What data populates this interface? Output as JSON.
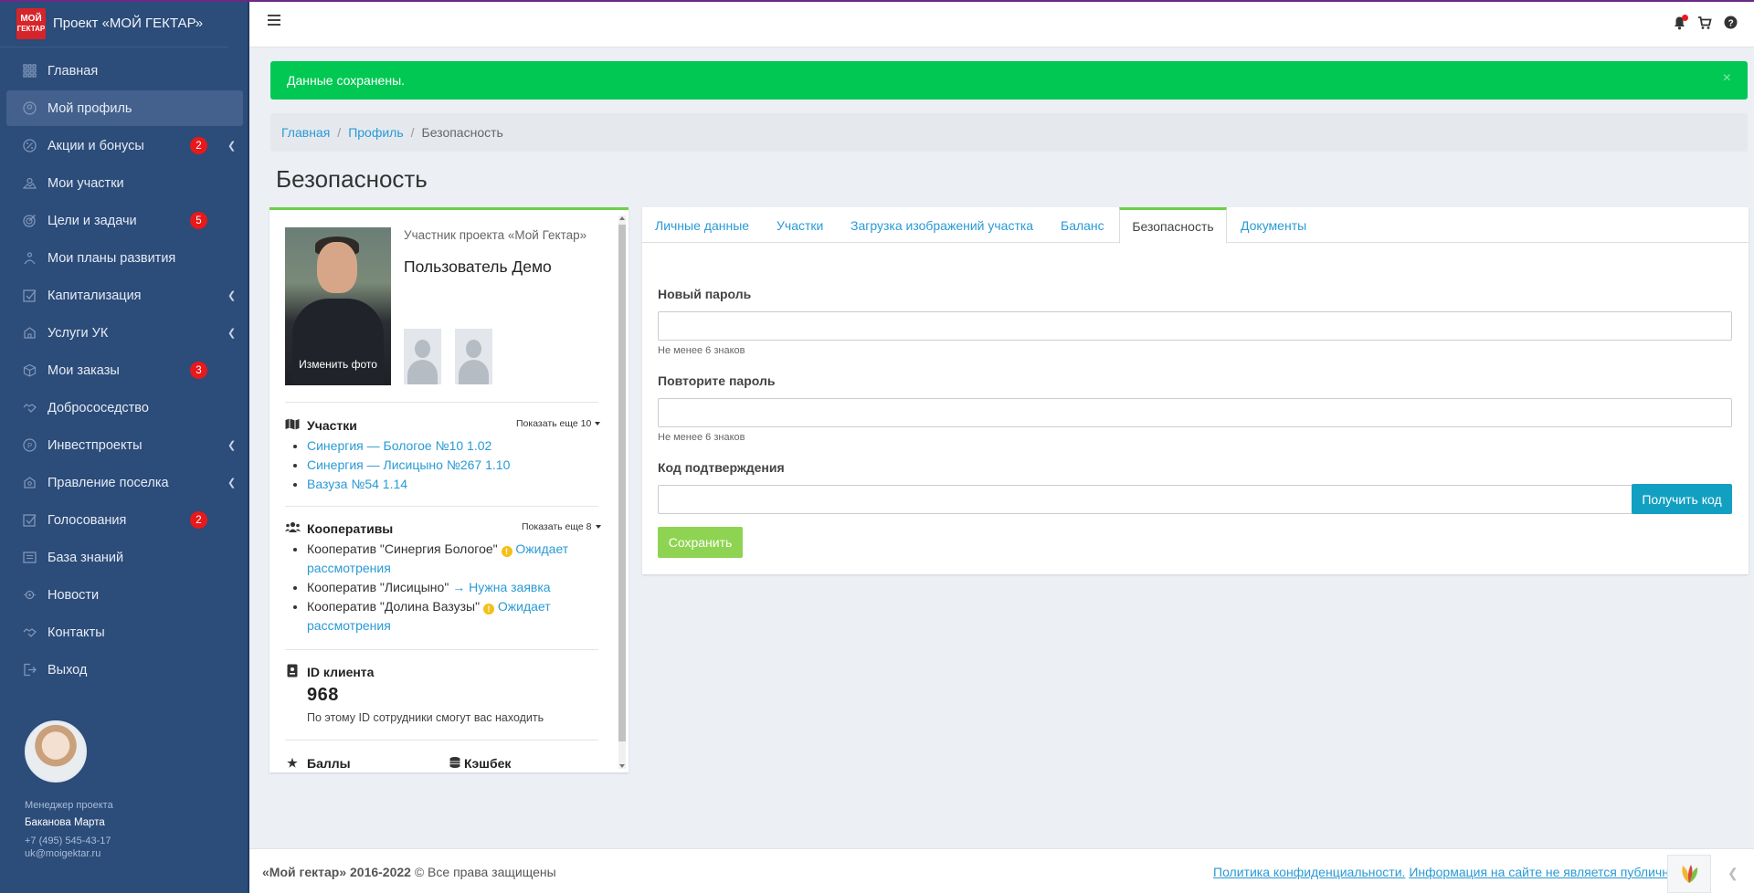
{
  "brand": {
    "logo_line1": "МОЙ",
    "logo_line2": "ГЕКТАР",
    "title": "Проект «МОЙ ГЕКТАР»"
  },
  "sidebar": {
    "items": [
      {
        "label": "Главная",
        "icon": "grid-icon"
      },
      {
        "label": "Мой профиль",
        "icon": "user-circle-icon",
        "active": true
      },
      {
        "label": "Акции и бонусы",
        "icon": "percent-icon",
        "badge": "2",
        "submenu": true
      },
      {
        "label": "Мои участки",
        "icon": "landscape-icon"
      },
      {
        "label": "Цели и задачи",
        "icon": "target-icon",
        "badge": "5"
      },
      {
        "label": "Мои планы развития",
        "icon": "plan-icon"
      },
      {
        "label": "Капитализация",
        "icon": "chart-check-icon",
        "submenu": true
      },
      {
        "label": "Услуги УК",
        "icon": "service-icon",
        "submenu": true
      },
      {
        "label": "Мои заказы",
        "icon": "box-icon",
        "badge": "3"
      },
      {
        "label": "Добрососедство",
        "icon": "handshake-icon"
      },
      {
        "label": "Инвестпроекты",
        "icon": "invest-icon",
        "submenu": true
      },
      {
        "label": "Правление поселка",
        "icon": "board-icon",
        "submenu": true
      },
      {
        "label": "Голосования",
        "icon": "vote-icon",
        "badge": "2"
      },
      {
        "label": "База знаний",
        "icon": "book-icon"
      },
      {
        "label": "Новости",
        "icon": "news-icon"
      },
      {
        "label": "Контакты",
        "icon": "contacts-icon"
      },
      {
        "label": "Выход",
        "icon": "logout-icon"
      }
    ]
  },
  "manager": {
    "role": "Менеджер проекта",
    "name": "Баканова Марта",
    "phone": "+7 (495) 545-43-17",
    "email": "uk@moigektar.ru"
  },
  "alert": {
    "text": "Данные сохранены.",
    "close": "×"
  },
  "breadcrumb": {
    "home": "Главная",
    "profile": "Профиль",
    "current": "Безопасность",
    "sep": "/"
  },
  "page_title": "Безопасность",
  "profile": {
    "role": "Участник проекта «Мой Гектар»",
    "name": "Пользователь Демо",
    "change_photo": "Изменить фото",
    "plots": {
      "title": "Участки",
      "show_more": "Показать еще 10",
      "items": [
        "Синергия — Бологое №10 1.02",
        "Синергия — Лисицыно №267 1.10",
        "Вазуза №54 1.14"
      ]
    },
    "coops": {
      "title": "Кооперативы",
      "show_more": "Показать еще 8",
      "items": [
        {
          "name": "Кооператив \"Синергия Бологое\"",
          "status": "Ожидает рассмотрения",
          "status_icon": "clock-warning-icon"
        },
        {
          "name": "Кооператив \"Лисицыно\"",
          "status": "Нужна заявка",
          "status_icon": "arrow-right-icon"
        },
        {
          "name": "Кооператив \"Долина Вазузы\"",
          "status": "Ожидает рассмотрения",
          "status_icon": "clock-warning-icon"
        }
      ]
    },
    "client": {
      "title": "ID клиента",
      "id": "968",
      "hint": "По этому ID сотрудники смогут вас находить"
    },
    "points_title": "Баллы",
    "cashback_title": "Кэшбек"
  },
  "tabs": [
    "Личные данные",
    "Участки",
    "Загрузка изображений участка",
    "Баланс",
    "Безопасность",
    "Документы"
  ],
  "active_tab": "Безопасность",
  "form": {
    "new_password_label": "Новый пароль",
    "new_password_value": "",
    "new_password_hint": "Не менее 6 знаков",
    "repeat_password_label": "Повторите пароль",
    "repeat_password_value": "",
    "repeat_password_hint": "Не менее 6 знаков",
    "code_label": "Код подтверждения",
    "code_value": "",
    "get_code_button": "Получить код",
    "save_button": "Сохранить"
  },
  "footer": {
    "brand": "«Мой гектар» 2016-2022",
    "copyright": "© Все права защищены",
    "privacy": "Политика конфиденциальности.",
    "disclaimer": "Информация на сайте не является публичной офертой"
  },
  "colors": {
    "sidebar_bg": "#2c4c79",
    "accent_blue": "#2a9ad4",
    "success_green": "#00c853",
    "badge_red": "#e8191b",
    "save_green": "#8ed452",
    "code_teal": "#12a0c2"
  }
}
